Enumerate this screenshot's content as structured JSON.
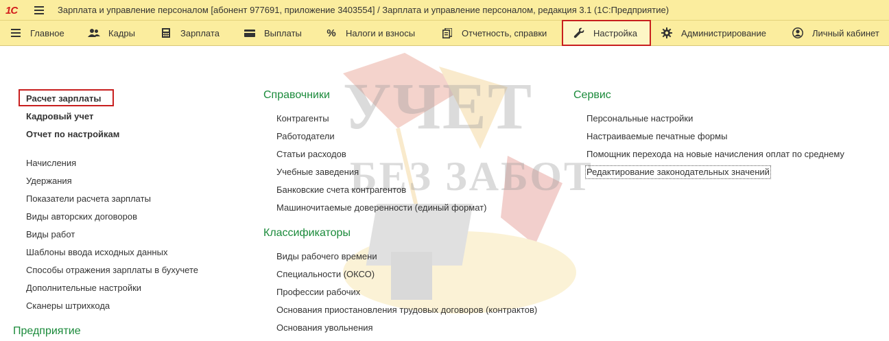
{
  "window": {
    "logo": "1С",
    "title": "Зарплата и управление персоналом [абонент 977691, приложение 3403554] / Зарплата и управление персоналом, редакция 3.1  (1С:Предприятие)"
  },
  "sections": [
    {
      "label": "Главное",
      "icon": "menu-icon"
    },
    {
      "label": "Кадры",
      "icon": "people-icon"
    },
    {
      "label": "Зарплата",
      "icon": "calculator-icon"
    },
    {
      "label": "Выплаты",
      "icon": "wallet-icon"
    },
    {
      "label": "Налоги и взносы",
      "icon": "percent-icon"
    },
    {
      "label": "Отчетность, справки",
      "icon": "documents-icon"
    },
    {
      "label": "Настройка",
      "icon": "wrench-icon",
      "active": true
    },
    {
      "label": "Администрирование",
      "icon": "gear-icon"
    },
    {
      "label": "Личный кабинет",
      "icon": "user-icon"
    }
  ],
  "watermark": {
    "line1": "УЧЕТ",
    "line2": "БЕЗ ЗАБОТ"
  },
  "left": {
    "bold_links": [
      "Расчет зарплаты",
      "Кадровый учет",
      "Отчет по настройкам"
    ],
    "links": [
      "Начисления",
      "Удержания",
      "Показатели расчета зарплаты",
      "Виды авторских договоров",
      "Виды работ",
      "Шаблоны ввода исходных данных",
      "Способы отражения зарплаты в бухучете",
      "Дополнительные настройки",
      "Сканеры штрихкода"
    ],
    "group_bottom": "Предприятие"
  },
  "middle": {
    "group1": "Справочники",
    "group1_links": [
      "Контрагенты",
      "Работодатели",
      "Статьи расходов",
      "Учебные заведения",
      "Банковские счета контрагентов",
      "Машиночитаемые доверенности (единый формат)"
    ],
    "group2": "Классификаторы",
    "group2_links": [
      "Виды рабочего времени",
      "Специальности (ОКСО)",
      "Профессии рабочих",
      "Основания приостановления трудовых договоров (контрактов)",
      "Основания увольнения"
    ]
  },
  "right": {
    "group": "Сервис",
    "links": [
      "Персональные настройки",
      "Настраиваемые печатные формы",
      "Помощник перехода на новые начисления оплат по среднему",
      "Редактирование законодательных значений"
    ]
  },
  "colors": {
    "panel": "#fbed9e",
    "group_heading": "#1a8a3a",
    "highlight": "#c81e1e"
  }
}
